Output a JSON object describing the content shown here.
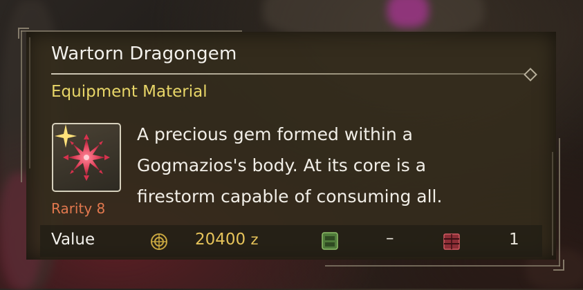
{
  "item": {
    "name": "Wartorn Dragongem",
    "category": "Equipment Material",
    "rarity": "Rarity 8",
    "description_lines": [
      "A precious gem formed within a",
      "Gogmazios's body. At its core is a",
      "firestorm capable of consuming all."
    ],
    "icon": "crimson-starburst-gem-icon"
  },
  "stats": {
    "value_label": "Value",
    "price_amount": "20400",
    "price_unit": "z",
    "item_box_value": "–",
    "chest_value": "1"
  },
  "colors": {
    "name": "#f3f1ec",
    "category": "#e8d668",
    "rarity": "#e2784e",
    "price": "#e6c35a",
    "gem": "#e0405a"
  }
}
